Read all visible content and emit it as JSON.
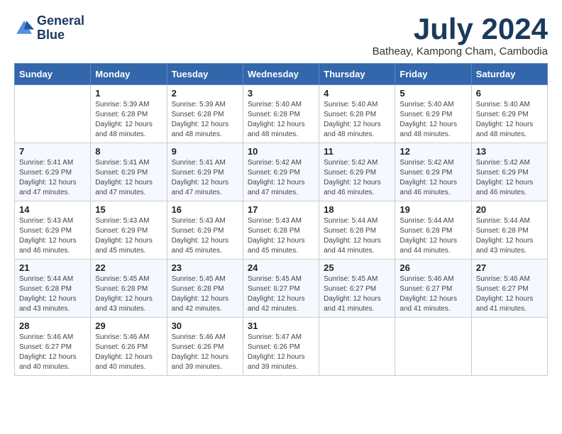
{
  "header": {
    "logo_line1": "General",
    "logo_line2": "Blue",
    "month_title": "July 2024",
    "subtitle": "Batheay, Kampong Cham, Cambodia"
  },
  "days_of_week": [
    "Sunday",
    "Monday",
    "Tuesday",
    "Wednesday",
    "Thursday",
    "Friday",
    "Saturday"
  ],
  "weeks": [
    [
      {
        "day": "",
        "sunrise": "",
        "sunset": "",
        "daylight": ""
      },
      {
        "day": "1",
        "sunrise": "Sunrise: 5:39 AM",
        "sunset": "Sunset: 6:28 PM",
        "daylight": "Daylight: 12 hours and 48 minutes."
      },
      {
        "day": "2",
        "sunrise": "Sunrise: 5:39 AM",
        "sunset": "Sunset: 6:28 PM",
        "daylight": "Daylight: 12 hours and 48 minutes."
      },
      {
        "day": "3",
        "sunrise": "Sunrise: 5:40 AM",
        "sunset": "Sunset: 6:28 PM",
        "daylight": "Daylight: 12 hours and 48 minutes."
      },
      {
        "day": "4",
        "sunrise": "Sunrise: 5:40 AM",
        "sunset": "Sunset: 6:28 PM",
        "daylight": "Daylight: 12 hours and 48 minutes."
      },
      {
        "day": "5",
        "sunrise": "Sunrise: 5:40 AM",
        "sunset": "Sunset: 6:29 PM",
        "daylight": "Daylight: 12 hours and 48 minutes."
      },
      {
        "day": "6",
        "sunrise": "Sunrise: 5:40 AM",
        "sunset": "Sunset: 6:29 PM",
        "daylight": "Daylight: 12 hours and 48 minutes."
      }
    ],
    [
      {
        "day": "7",
        "sunrise": "Sunrise: 5:41 AM",
        "sunset": "Sunset: 6:29 PM",
        "daylight": "Daylight: 12 hours and 47 minutes."
      },
      {
        "day": "8",
        "sunrise": "Sunrise: 5:41 AM",
        "sunset": "Sunset: 6:29 PM",
        "daylight": "Daylight: 12 hours and 47 minutes."
      },
      {
        "day": "9",
        "sunrise": "Sunrise: 5:41 AM",
        "sunset": "Sunset: 6:29 PM",
        "daylight": "Daylight: 12 hours and 47 minutes."
      },
      {
        "day": "10",
        "sunrise": "Sunrise: 5:42 AM",
        "sunset": "Sunset: 6:29 PM",
        "daylight": "Daylight: 12 hours and 47 minutes."
      },
      {
        "day": "11",
        "sunrise": "Sunrise: 5:42 AM",
        "sunset": "Sunset: 6:29 PM",
        "daylight": "Daylight: 12 hours and 46 minutes."
      },
      {
        "day": "12",
        "sunrise": "Sunrise: 5:42 AM",
        "sunset": "Sunset: 6:29 PM",
        "daylight": "Daylight: 12 hours and 46 minutes."
      },
      {
        "day": "13",
        "sunrise": "Sunrise: 5:42 AM",
        "sunset": "Sunset: 6:29 PM",
        "daylight": "Daylight: 12 hours and 46 minutes."
      }
    ],
    [
      {
        "day": "14",
        "sunrise": "Sunrise: 5:43 AM",
        "sunset": "Sunset: 6:29 PM",
        "daylight": "Daylight: 12 hours and 46 minutes."
      },
      {
        "day": "15",
        "sunrise": "Sunrise: 5:43 AM",
        "sunset": "Sunset: 6:29 PM",
        "daylight": "Daylight: 12 hours and 45 minutes."
      },
      {
        "day": "16",
        "sunrise": "Sunrise: 5:43 AM",
        "sunset": "Sunset: 6:29 PM",
        "daylight": "Daylight: 12 hours and 45 minutes."
      },
      {
        "day": "17",
        "sunrise": "Sunrise: 5:43 AM",
        "sunset": "Sunset: 6:28 PM",
        "daylight": "Daylight: 12 hours and 45 minutes."
      },
      {
        "day": "18",
        "sunrise": "Sunrise: 5:44 AM",
        "sunset": "Sunset: 6:28 PM",
        "daylight": "Daylight: 12 hours and 44 minutes."
      },
      {
        "day": "19",
        "sunrise": "Sunrise: 5:44 AM",
        "sunset": "Sunset: 6:28 PM",
        "daylight": "Daylight: 12 hours and 44 minutes."
      },
      {
        "day": "20",
        "sunrise": "Sunrise: 5:44 AM",
        "sunset": "Sunset: 6:28 PM",
        "daylight": "Daylight: 12 hours and 43 minutes."
      }
    ],
    [
      {
        "day": "21",
        "sunrise": "Sunrise: 5:44 AM",
        "sunset": "Sunset: 6:28 PM",
        "daylight": "Daylight: 12 hours and 43 minutes."
      },
      {
        "day": "22",
        "sunrise": "Sunrise: 5:45 AM",
        "sunset": "Sunset: 6:28 PM",
        "daylight": "Daylight: 12 hours and 43 minutes."
      },
      {
        "day": "23",
        "sunrise": "Sunrise: 5:45 AM",
        "sunset": "Sunset: 6:28 PM",
        "daylight": "Daylight: 12 hours and 42 minutes."
      },
      {
        "day": "24",
        "sunrise": "Sunrise: 5:45 AM",
        "sunset": "Sunset: 6:27 PM",
        "daylight": "Daylight: 12 hours and 42 minutes."
      },
      {
        "day": "25",
        "sunrise": "Sunrise: 5:45 AM",
        "sunset": "Sunset: 6:27 PM",
        "daylight": "Daylight: 12 hours and 41 minutes."
      },
      {
        "day": "26",
        "sunrise": "Sunrise: 5:46 AM",
        "sunset": "Sunset: 6:27 PM",
        "daylight": "Daylight: 12 hours and 41 minutes."
      },
      {
        "day": "27",
        "sunrise": "Sunrise: 5:46 AM",
        "sunset": "Sunset: 6:27 PM",
        "daylight": "Daylight: 12 hours and 41 minutes."
      }
    ],
    [
      {
        "day": "28",
        "sunrise": "Sunrise: 5:46 AM",
        "sunset": "Sunset: 6:27 PM",
        "daylight": "Daylight: 12 hours and 40 minutes."
      },
      {
        "day": "29",
        "sunrise": "Sunrise: 5:46 AM",
        "sunset": "Sunset: 6:26 PM",
        "daylight": "Daylight: 12 hours and 40 minutes."
      },
      {
        "day": "30",
        "sunrise": "Sunrise: 5:46 AM",
        "sunset": "Sunset: 6:26 PM",
        "daylight": "Daylight: 12 hours and 39 minutes."
      },
      {
        "day": "31",
        "sunrise": "Sunrise: 5:47 AM",
        "sunset": "Sunset: 6:26 PM",
        "daylight": "Daylight: 12 hours and 39 minutes."
      },
      {
        "day": "",
        "sunrise": "",
        "sunset": "",
        "daylight": ""
      },
      {
        "day": "",
        "sunrise": "",
        "sunset": "",
        "daylight": ""
      },
      {
        "day": "",
        "sunrise": "",
        "sunset": "",
        "daylight": ""
      }
    ]
  ]
}
